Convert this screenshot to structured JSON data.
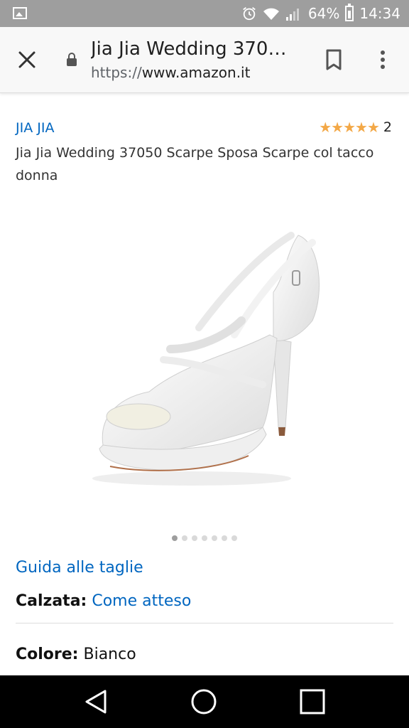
{
  "status_bar": {
    "battery_percent": "64%",
    "time": "14:34",
    "icons": [
      "image-icon",
      "alarm-icon",
      "wifi-icon",
      "signal-icon",
      "battery-icon"
    ]
  },
  "browser": {
    "page_title": "Jia Jia Wedding 370…",
    "url_scheme": "https://",
    "url_domain": "www.amazon.it",
    "icons": [
      "close-icon",
      "lock-icon",
      "bookmark-icon",
      "more-vert-icon"
    ]
  },
  "product": {
    "brand": "JIA JIA",
    "rating_stars": 5,
    "stars_text": "★★★★★",
    "rating_count": "2",
    "title": "Jia Jia Wedding 37050 Scarpe Sposa Scarpe col tacco donna",
    "image_count": 7,
    "active_image_index": 0,
    "size_guide_link": "Guida alle taglie",
    "fit_label": "Calzata:",
    "fit_value": "Come atteso",
    "color_label": "Colore:",
    "color_value": "Bianco"
  },
  "colors": {
    "link": "#0066c0",
    "star": "#f3a847",
    "status_bar": "#9e9e9e",
    "nav_bar": "#000000"
  },
  "nav_bar": {
    "icons": [
      "back-icon",
      "home-icon",
      "recent-apps-icon"
    ]
  }
}
